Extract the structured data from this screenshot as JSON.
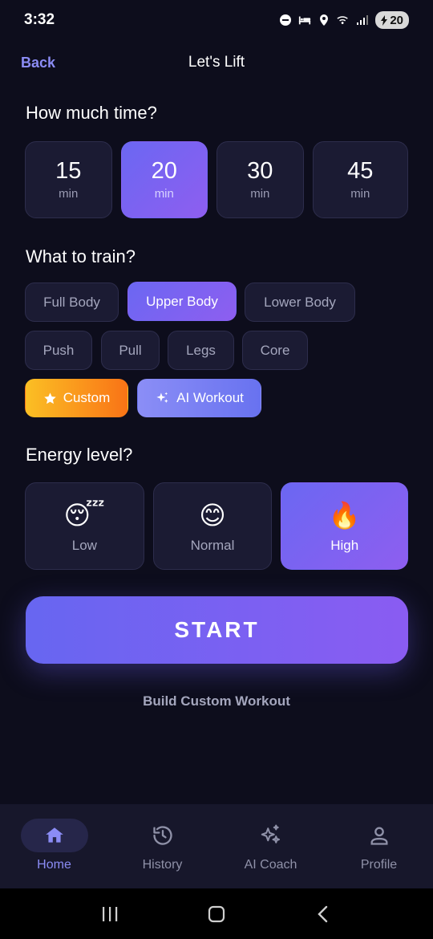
{
  "status": {
    "time": "3:32",
    "battery": "20"
  },
  "header": {
    "back_label": "Back",
    "title": "Let's Lift"
  },
  "time_section": {
    "title": "How much time?",
    "options": [
      {
        "value": "15",
        "unit": "min",
        "selected": false
      },
      {
        "value": "20",
        "unit": "min",
        "selected": true
      },
      {
        "value": "30",
        "unit": "min",
        "selected": false
      },
      {
        "value": "45",
        "unit": "min",
        "selected": false
      }
    ]
  },
  "train_section": {
    "title": "What to train?",
    "chips": [
      {
        "label": "Full Body",
        "selected": false
      },
      {
        "label": "Upper Body",
        "selected": true
      },
      {
        "label": "Lower Body",
        "selected": false
      },
      {
        "label": "Push",
        "selected": false
      },
      {
        "label": "Pull",
        "selected": false
      },
      {
        "label": "Legs",
        "selected": false
      },
      {
        "label": "Core",
        "selected": false
      },
      {
        "label": "Custom",
        "icon": "star-icon"
      },
      {
        "label": "AI Workout",
        "icon": "sparkle-icon"
      }
    ]
  },
  "energy_section": {
    "title": "Energy level?",
    "options": [
      {
        "emoji": "😴",
        "label": "Low",
        "selected": false
      },
      {
        "emoji": "😊",
        "label": "Normal",
        "selected": false
      },
      {
        "emoji": "🔥",
        "label": "High",
        "selected": true
      }
    ]
  },
  "start_label": "START",
  "build_custom_label": "Build Custom Workout",
  "bottom_nav": [
    {
      "label": "Home",
      "icon": "home-icon",
      "active": true
    },
    {
      "label": "History",
      "icon": "history-icon",
      "active": false
    },
    {
      "label": "AI Coach",
      "icon": "sparkles-icon",
      "active": false
    },
    {
      "label": "Profile",
      "icon": "person-icon",
      "active": false
    }
  ],
  "colors": {
    "background": "#0d0d1c",
    "accent": "#8b8cf5",
    "tile": "#1b1b33",
    "gradient_start": "#6b67f2",
    "gradient_end": "#8e5ef0",
    "custom_start": "#fbbf24",
    "custom_end": "#f97316"
  }
}
